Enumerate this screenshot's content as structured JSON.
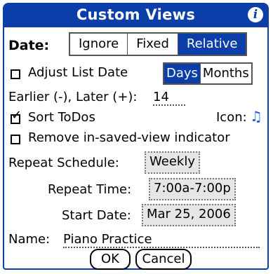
{
  "title": "Custom Views",
  "date": {
    "label": "Date:",
    "options": [
      "Ignore",
      "Fixed",
      "Relative"
    ],
    "selected": "Relative"
  },
  "adjust_list_date": {
    "label": "Adjust List Date",
    "checked": false,
    "options": [
      "Days",
      "Months"
    ],
    "selected": "Days"
  },
  "offset": {
    "label": "Earlier (-), Later (+):",
    "value": "14"
  },
  "sort_todos": {
    "label": "Sort ToDos",
    "checked": true
  },
  "icon": {
    "label": "Icon:",
    "symbol": "♫"
  },
  "remove_indicator": {
    "label": "Remove in-saved-view indicator",
    "checked": false
  },
  "repeat_schedule": {
    "label": "Repeat Schedule:",
    "value": "Weekly"
  },
  "repeat_time": {
    "label": "Repeat Time:",
    "value": "7:00a-7:00p"
  },
  "start_date": {
    "label": "Start Date:",
    "value": "Mar 25, 2006"
  },
  "name": {
    "label": "Name:",
    "value": "Piano Practice"
  },
  "buttons": {
    "ok": "OK",
    "cancel": "Cancel"
  },
  "colors": {
    "accent": "#0b3ea8",
    "note_icon": "#1f5cd6"
  }
}
